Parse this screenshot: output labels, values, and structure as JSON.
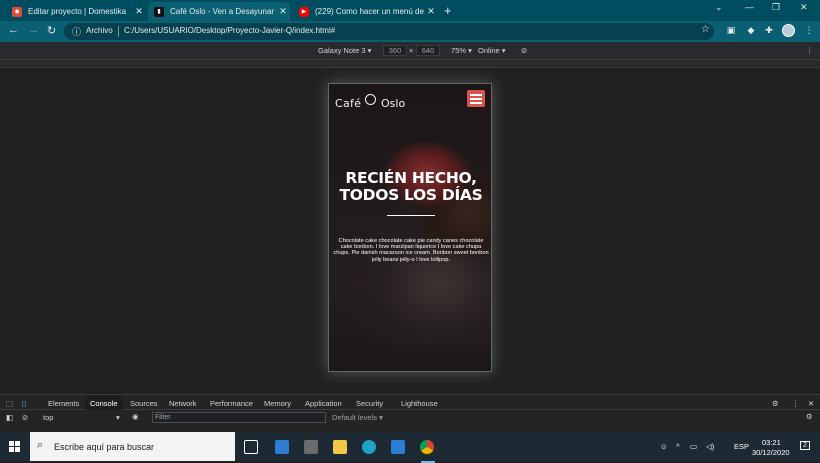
{
  "browser": {
    "tabs": [
      {
        "title": "Editar proyecto | Domestika",
        "favicon": "domestika-icon",
        "color": "#e04b3a"
      },
      {
        "title": "Café Oslo - Ven a Desayunar",
        "favicon": "coffee-cup-icon",
        "color": "#111111"
      },
      {
        "title": "(229) Como hacer un menú de re",
        "favicon": "youtube-icon",
        "color": "#ff0000"
      }
    ],
    "address": {
      "scheme_label": "Archivo",
      "url": "C:/Users/USUARIO/Desktop/Proyecto-Javier-Q/index.html#"
    }
  },
  "device_toolbar": {
    "device": "Galaxy Note 3",
    "width": "360",
    "height": "640",
    "zoom": "75%",
    "network": "Online"
  },
  "site": {
    "logo_word1": "Café",
    "logo_word2": "Oslo",
    "hero_line1": "RECIÉN HECHO,",
    "hero_line2": "TODOS LOS DÍAS",
    "hero_text": "Chocolate cake chocolate cake pie candy canes chocolate cake bonbon. I love marzipan liquorice I love cake chupa chups. Pie danish macaroon ice cream. Bonbon sweet bonbon jelly beans jelly-o I love lollipop."
  },
  "devtools": {
    "tabs": [
      "Elements",
      "Console",
      "Sources",
      "Network",
      "Performance",
      "Memory",
      "Application",
      "Security",
      "Lighthouse"
    ],
    "active_tab": "Console",
    "context": "top",
    "filter_placeholder": "Filter",
    "levels": "Default levels"
  },
  "taskbar": {
    "search_placeholder": "Escribe aquí para buscar",
    "language": "ESP",
    "time": "03:21",
    "date": "30/12/2020",
    "notifications": "2"
  }
}
